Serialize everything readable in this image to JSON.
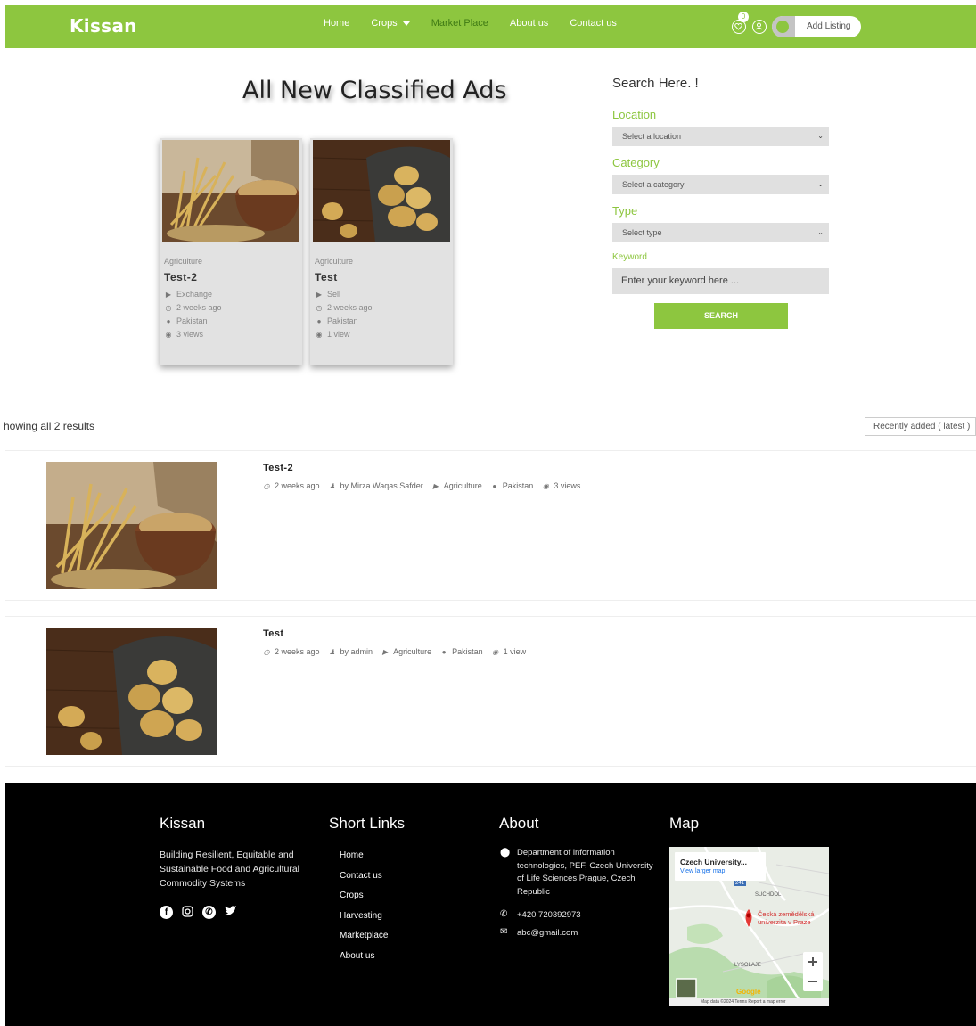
{
  "header": {
    "logo": "Kissan",
    "nav": [
      "Home",
      "Crops",
      "Market Place",
      "About us",
      "Contact us"
    ],
    "wishlist_count": "0",
    "add_listing": "Add Listing",
    "brand_color": "#8dc63f"
  },
  "hero": {
    "title": "All New Classified Ads"
  },
  "cards": [
    {
      "category": "Agriculture",
      "title": "Test-2",
      "type": "Exchange",
      "time": "2 weeks ago",
      "location": "Pakistan",
      "views": "3 views"
    },
    {
      "category": "Agriculture",
      "title": "Test",
      "type": "Sell",
      "time": "2 weeks ago",
      "location": "Pakistan",
      "views": "1 view"
    }
  ],
  "search": {
    "title": "Search Here. !",
    "location_label": "Location",
    "location_value": "Select a location",
    "category_label": "Category",
    "category_value": "Select a category",
    "type_label": "Type",
    "type_value": "Select type",
    "keyword_label": "Keyword",
    "keyword_placeholder": "Enter your keyword here ...",
    "button": "SEARCH"
  },
  "results": {
    "count_text": "howing all 2 results",
    "sort": "Recently added ( latest )"
  },
  "listings": [
    {
      "title": "Test-2",
      "time": "2 weeks ago",
      "author": "by Mirza Waqas Safder",
      "category": "Agriculture",
      "location": "Pakistan",
      "views": "3 views"
    },
    {
      "title": "Test",
      "time": "2 weeks ago",
      "author": "by admin",
      "category": "Agriculture",
      "location": "Pakistan",
      "views": "1 view"
    }
  ],
  "footer": {
    "brand": "Kissan",
    "tagline": "Building Resilient, Equitable and Sustainable Food and Agricultural Commodity Systems",
    "links_title": "Short Links",
    "links": [
      "Home",
      "Contact us",
      "Crops",
      "Harvesting",
      "Marketplace",
      "About us"
    ],
    "about_title": "About",
    "address": "Department of information technologies, PEF, Czech University of Life Sciences Prague, Czech Republic",
    "phone": "+420 720392973",
    "email": "abc@gmail.com",
    "map_title": "Map",
    "map": {
      "place": "Czech University...",
      "larger": "View larger map",
      "pin_label_1": "Česká zemědělská",
      "pin_label_2": "univerzita v Praze",
      "district_1": "SUCHDOL",
      "district_2": "LYSOLAJE",
      "road": "241",
      "google": "Google",
      "attribution": "Map data ©2024   Terms   Report a map error"
    }
  }
}
